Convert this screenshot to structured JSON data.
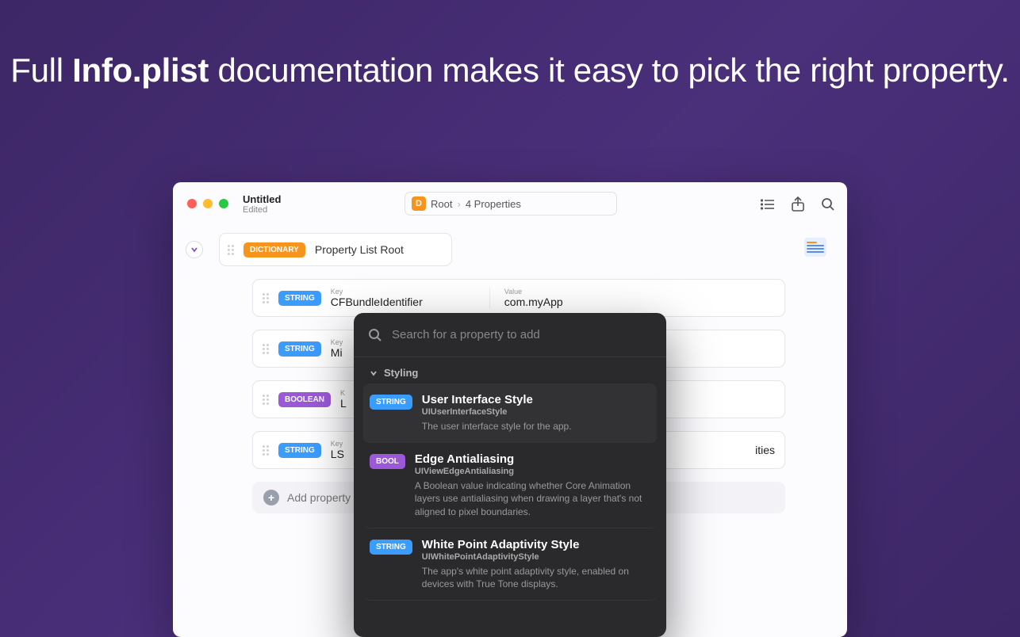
{
  "headline": {
    "pre": "Full ",
    "bold": "Info.plist",
    "post": " documentation makes it easy to pick the right property."
  },
  "window": {
    "title": "Untitled",
    "subtitle": "Edited",
    "breadcrumb": {
      "badge": "D",
      "root": "Root",
      "count": "4 Properties"
    }
  },
  "root": {
    "badge": "DICTIONARY",
    "label": "Property List Root"
  },
  "labels": {
    "key": "Key",
    "value": "Value"
  },
  "rows": [
    {
      "type": "STRING",
      "key": "CFBundleIdentifier",
      "value": "com.myApp"
    },
    {
      "type": "STRING",
      "key": "Mi",
      "value": ""
    },
    {
      "type": "BOOLEAN",
      "key": "L",
      "value": ""
    },
    {
      "type": "STRING",
      "key": "LS",
      "value": "ities"
    }
  ],
  "add_button": "Add property to",
  "popover": {
    "search_placeholder": "Search for a property to add",
    "section": "Styling",
    "items": [
      {
        "badge": "STRING",
        "title": "User Interface Style",
        "key": "UIUserInterfaceStyle",
        "desc": "The user interface style for the app."
      },
      {
        "badge": "BOOL",
        "title": "Edge Antialiasing",
        "key": "UIViewEdgeAntialiasing",
        "desc": "A Boolean value indicating whether Core Animation layers use antialiasing when drawing a layer that's not aligned to pixel boundaries."
      },
      {
        "badge": "STRING",
        "title": "White Point Adaptivity Style",
        "key": "UIWhitePointAdaptivityStyle",
        "desc": "The app's white point adaptivity style, enabled on devices with True Tone displays."
      }
    ]
  }
}
